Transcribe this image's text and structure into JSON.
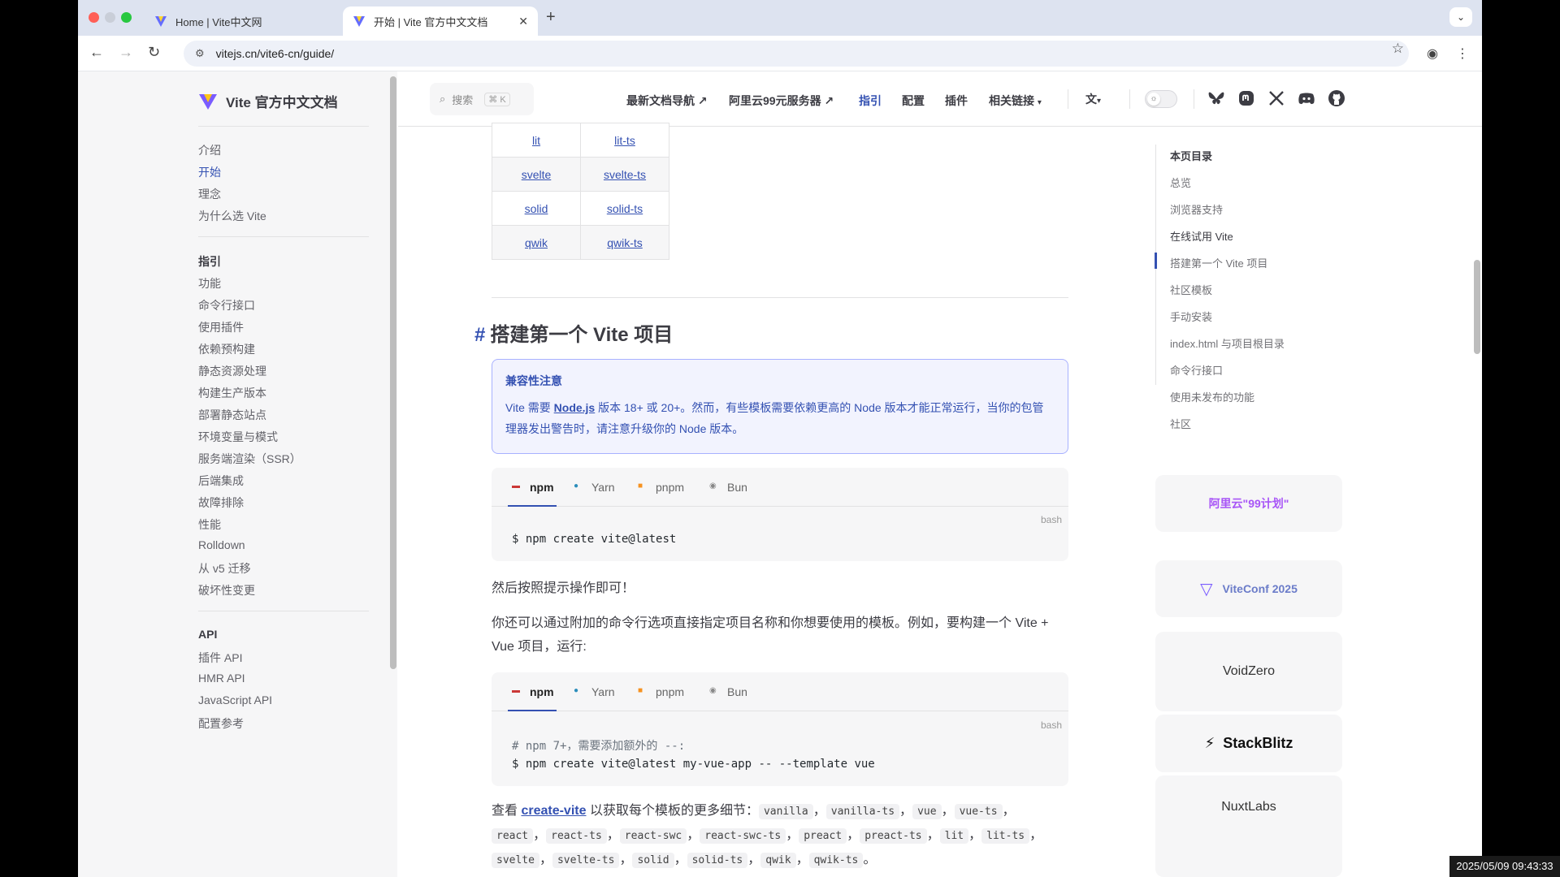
{
  "browser": {
    "tabs": [
      {
        "title": "Home | Vite中文网"
      },
      {
        "title": "开始 | Vite 官方中文文档"
      }
    ],
    "url": "vitejs.cn/vite6-cn/guide/",
    "timestamp": "2025/05/09 09:43:33"
  },
  "colors": {
    "accent": "#3451b2",
    "tip_border": "#a8b1ff"
  },
  "sidebar": {
    "site_title": "Vite 官方中文文档",
    "group1": [
      "介绍",
      "开始",
      "理念",
      "为什么选 Vite"
    ],
    "group2_title": "指引",
    "group2": [
      "功能",
      "命令行接口",
      "使用插件",
      "依赖预构建",
      "静态资源处理",
      "构建生产版本",
      "部署静态站点",
      "环境变量与模式",
      "服务端渲染（SSR）",
      "后端集成",
      "故障排除",
      "性能",
      "Rolldown",
      "从 v5 迁移",
      "破坏性变更"
    ],
    "group3_title": "API",
    "group3": [
      "插件 API",
      "HMR API",
      "JavaScript API",
      "配置参考"
    ]
  },
  "topnav": {
    "search_label": "搜索",
    "search_kbd": "⌘ K",
    "links": [
      "最新文档导航 ↗",
      "阿里云99元服务器 ↗",
      "指引",
      "配置",
      "插件",
      "相关链接"
    ],
    "lang_icon": "translate-icon",
    "social_icons": [
      "bluesky-icon",
      "mastodon-icon",
      "x-icon",
      "discord-icon",
      "github-icon"
    ]
  },
  "table": {
    "rows": [
      [
        "lit",
        "lit-ts"
      ],
      [
        "svelte",
        "svelte-ts"
      ],
      [
        "solid",
        "solid-ts"
      ],
      [
        "qwik",
        "qwik-ts"
      ]
    ]
  },
  "section": {
    "hash": "#",
    "heading": "搭建第一个 Vite 项目",
    "tip_title": "兼容性注意",
    "tip_pre": "Vite 需要 ",
    "tip_link": "Node.js",
    "tip_post": " 版本 18+ 或 20+。然而，有些模板需要依赖更高的 Node 版本才能正常运行，当你的包管理器发出警告时，请注意升级你的 Node 版本。"
  },
  "code_tabs": [
    "npm",
    "Yarn",
    "pnpm",
    "Bun"
  ],
  "code_lang": "bash",
  "code1": {
    "prompt": "$",
    "cmd": "npm create vite@latest"
  },
  "para1": "然后按照提示操作即可！",
  "para2": "你还可以通过附加的命令行选项直接指定项目名称和你想要使用的模板。例如，要构建一个 Vite + Vue 项目，运行:",
  "code2": {
    "comment": "# npm 7+，需要添加额外的 --:",
    "prompt": "$",
    "cmd": "npm create vite@latest my-vue-app -- --template vue"
  },
  "para3": {
    "pre": "查看 ",
    "link": "create-vite",
    "mid": " 以获取每个模板的更多细节：",
    "templates": [
      "vanilla",
      "vanilla-ts",
      "vue",
      "vue-ts",
      "react",
      "react-ts",
      "react-swc",
      "react-swc-ts",
      "preact",
      "preact-ts",
      "lit",
      "lit-ts",
      "svelte",
      "svelte-ts",
      "solid",
      "solid-ts",
      "qwik",
      "qwik-ts"
    ],
    "end": "。"
  },
  "outline": {
    "title": "本页目录",
    "items": [
      "总览",
      "浏览器支持",
      "在线试用 Vite",
      "搭建第一个 Vite 项目",
      "社区模板",
      "手动安装",
      "index.html 与项目根目录",
      "命令行接口",
      "使用未发布的功能",
      "社区"
    ]
  },
  "sponsors": [
    "阿里云\"99计划\"",
    "ViteConf 2025",
    "VoidZero",
    "StackBlitz",
    "NuxtLabs"
  ]
}
